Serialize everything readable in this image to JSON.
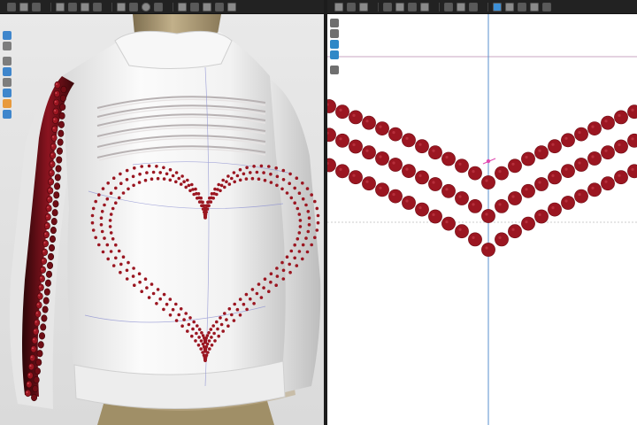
{
  "app": {
    "panels": [
      "3d-garment-window",
      "2d-pattern-window"
    ]
  },
  "toolbar_3d": {
    "icons": [
      "select-mesh-icon",
      "transform-icon",
      "pin-icon",
      "sew-icon",
      "fold-icon",
      "button-icon",
      "zipper-icon",
      "avatar-icon",
      "measure-icon",
      "snapshot-icon",
      "light-icon",
      "render-icon",
      "record-icon",
      "texture-icon",
      "graphic-icon",
      "topstitch-icon"
    ]
  },
  "toolbar_2d": {
    "icons": [
      "transform-pattern-icon",
      "edit-point-icon",
      "add-point-icon",
      "curve-point-icon",
      "rectangle-icon",
      "polygon-icon",
      "internal-line-icon",
      "segment-sew-icon",
      "free-sew-icon",
      "check-sewing-icon",
      "trim-icon",
      "notch-icon",
      "pleat-icon",
      "graphic-pattern-icon",
      "texture-pattern-icon"
    ]
  },
  "colors": {
    "garment": "#f4f4f4",
    "sequin": "#9b1621",
    "sequin_highlight": "#d04a55",
    "avatar_skin": "#b3a17a",
    "guide_line": "#4f86c6",
    "ui_dark": "#222222"
  }
}
